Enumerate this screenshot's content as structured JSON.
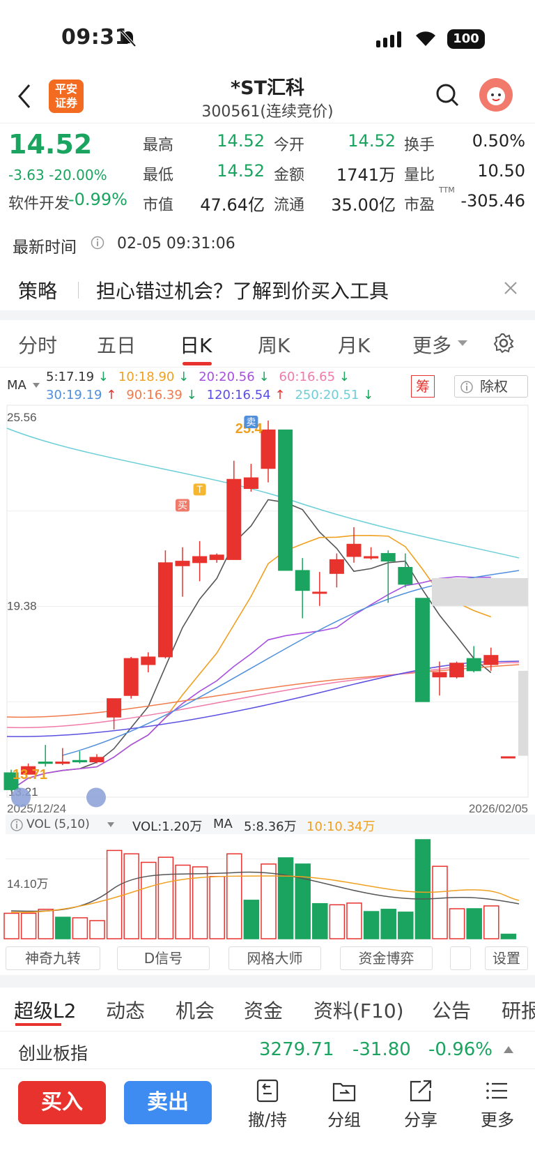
{
  "status_bar": {
    "time": "09:31",
    "battery": "100"
  },
  "header": {
    "title": "*ST汇科",
    "subtitle": "300561(连续竞价)",
    "logo_text": "平安\n证券"
  },
  "quote": {
    "price": "14.52",
    "change": "-3.63 -20.00%",
    "sector": "软件开发",
    "sector_change": "-0.99%",
    "stats": [
      {
        "label": "最高",
        "value": "14.52"
      },
      {
        "label": "今开",
        "value": "14.52"
      },
      {
        "label": "换手",
        "value": "0.50%"
      },
      {
        "label": "最低",
        "value": "14.52"
      },
      {
        "label": "金额",
        "value": "1741万"
      },
      {
        "label": "量比",
        "value": "10.50"
      },
      {
        "label": "市值",
        "value": "47.64亿"
      },
      {
        "label": "流通",
        "value": "35.00亿"
      },
      {
        "label": "市盈",
        "value": "-305.46"
      }
    ],
    "pe_superscript": "TTM",
    "update_label": "最新时间",
    "update_time": "02-05 09:31:06"
  },
  "banner": {
    "tag": "策略",
    "text": "担心错过机会？了解到价买入工具"
  },
  "period_tabs": [
    "分时",
    "五日",
    "日K",
    "周K",
    "月K",
    "更多"
  ],
  "active_period": "日K",
  "ma_legend": {
    "label": "MA",
    "items": [
      {
        "text": "5:17.19",
        "color": "#333333",
        "dir": "down"
      },
      {
        "text": "10:18.90",
        "color": "#f0a020",
        "dir": "down"
      },
      {
        "text": "20:20.56",
        "color": "#a64fe0",
        "dir": "down"
      },
      {
        "text": "60:16.65",
        "color": "#f07aa8",
        "dir": "down"
      },
      {
        "text": "30:19.19",
        "color": "#4f8fdc",
        "dir": "up"
      },
      {
        "text": "90:16.39",
        "color": "#f07a4a",
        "dir": "down"
      },
      {
        "text": "120:16.54",
        "color": "#5a4fe0",
        "dir": "up"
      },
      {
        "text": "250:20.51",
        "color": "#6ccfd8",
        "dir": "down"
      }
    ],
    "chip_label": "筹",
    "adjust_label": "除权"
  },
  "chart_data": [
    {
      "type": "candlestick",
      "y_top_label": "25.56",
      "y_mid_label": "19.38",
      "y_bottom_label": "13.21",
      "ylim": [
        13.21,
        25.56
      ],
      "x_start": "2025/12/24",
      "x_end": "2026/02/05",
      "annotations": {
        "high": "25.4",
        "low": "13.71",
        "buy": "买",
        "sell": "卖",
        "t": "T"
      },
      "candles": [
        {
          "o": 14.0,
          "c": 13.45,
          "h": 14.1,
          "l": 13.4
        },
        {
          "o": 13.95,
          "c": 14.2,
          "h": 14.3,
          "l": 13.95
        },
        {
          "o": 14.35,
          "c": 14.3,
          "h": 14.9,
          "l": 14.2
        },
        {
          "o": 14.3,
          "c": 14.35,
          "h": 14.8,
          "l": 14.25
        },
        {
          "o": 14.4,
          "c": 14.35,
          "h": 14.7,
          "l": 14.3
        },
        {
          "o": 14.35,
          "c": 14.5,
          "h": 14.6,
          "l": 14.3
        },
        {
          "o": 15.8,
          "c": 16.4,
          "h": 16.4,
          "l": 15.4
        },
        {
          "o": 16.5,
          "c": 17.7,
          "h": 17.75,
          "l": 16.4
        },
        {
          "o": 17.5,
          "c": 17.75,
          "h": 17.9,
          "l": 17.25
        },
        {
          "o": 17.75,
          "c": 20.8,
          "h": 21.2,
          "l": 17.7
        },
        {
          "o": 20.7,
          "c": 20.85,
          "h": 21.3,
          "l": 19.7
        },
        {
          "o": 20.8,
          "c": 21.0,
          "h": 21.5,
          "l": 20.2
        },
        {
          "o": 20.9,
          "c": 21.05,
          "h": 21.1,
          "l": 20.8
        },
        {
          "o": 20.9,
          "c": 23.5,
          "h": 24.1,
          "l": 20.9
        },
        {
          "o": 23.2,
          "c": 23.55,
          "h": 24.0,
          "l": 23.1
        },
        {
          "o": 23.85,
          "c": 25.1,
          "h": 25.4,
          "l": 23.4
        },
        {
          "o": 25.1,
          "c": 20.55,
          "h": 25.1,
          "l": 20.55
        },
        {
          "o": 20.55,
          "c": 19.9,
          "h": 20.95,
          "l": 19.0
        },
        {
          "o": 19.85,
          "c": 19.85,
          "h": 20.5,
          "l": 19.4
        },
        {
          "o": 20.45,
          "c": 20.9,
          "h": 21.1,
          "l": 20.0
        },
        {
          "o": 21.0,
          "c": 21.4,
          "h": 21.95,
          "l": 20.8
        },
        {
          "o": 20.95,
          "c": 21.0,
          "h": 21.3,
          "l": 20.9
        },
        {
          "o": 21.1,
          "c": 20.85,
          "h": 21.2,
          "l": 19.5
        },
        {
          "o": 20.65,
          "c": 20.1,
          "h": 21.1,
          "l": 20.0
        },
        {
          "o": 19.65,
          "c": 16.3,
          "h": 19.65,
          "l": 16.3
        },
        {
          "o": 17.1,
          "c": 17.25,
          "h": 17.6,
          "l": 16.5
        },
        {
          "o": 17.1,
          "c": 17.55,
          "h": 17.6,
          "l": 17.05
        },
        {
          "o": 17.7,
          "c": 17.3,
          "h": 18.1,
          "l": 17.25
        },
        {
          "o": 17.5,
          "c": 17.8,
          "h": 18.05,
          "l": 17.3
        },
        {
          "o": 14.52,
          "c": 14.52,
          "h": 14.52,
          "l": 14.52
        }
      ]
    },
    {
      "type": "bar",
      "title": "VOL (5,10)",
      "vol_label": "VOL:1.20万",
      "ma_label": "MA",
      "ma5": "5:8.36万",
      "ma10": "10:10.34万",
      "y_label": "14.10万",
      "values": [
        4.5,
        4.5,
        5.2,
        3.8,
        3.7,
        3.2,
        15.6,
        15.0,
        13.5,
        14.4,
        13.0,
        12.7,
        11.0,
        15.0,
        6.8,
        13.2,
        14.3,
        13.2,
        6.2,
        6.0,
        6.3,
        4.8,
        5.2,
        4.7,
        17.5,
        12.8,
        5.3,
        5.3,
        5.8,
        0.8
      ],
      "colors": [
        "red",
        "red",
        "red",
        "green",
        "red",
        "red",
        "red",
        "red",
        "red",
        "red",
        "red",
        "red",
        "red",
        "red",
        "green",
        "red",
        "green",
        "green",
        "green",
        "red",
        "red",
        "green",
        "green",
        "green",
        "green",
        "red",
        "red",
        "green",
        "red",
        "green"
      ]
    }
  ],
  "indicator_tabs": [
    "神奇九转",
    "D信号",
    "网格大师",
    "资金博弈",
    "设置"
  ],
  "bottom_tabs": [
    "超级L2",
    "动态",
    "机会",
    "资金",
    "资料(F10)",
    "公告",
    "研报"
  ],
  "index_row": {
    "name": "创业板指",
    "value": "3279.71",
    "change": "-31.80",
    "pct": "-0.96%"
  },
  "actions": {
    "buy": "买入",
    "sell": "卖出",
    "tools": [
      "撤/持",
      "分组",
      "分享",
      "更多"
    ]
  }
}
